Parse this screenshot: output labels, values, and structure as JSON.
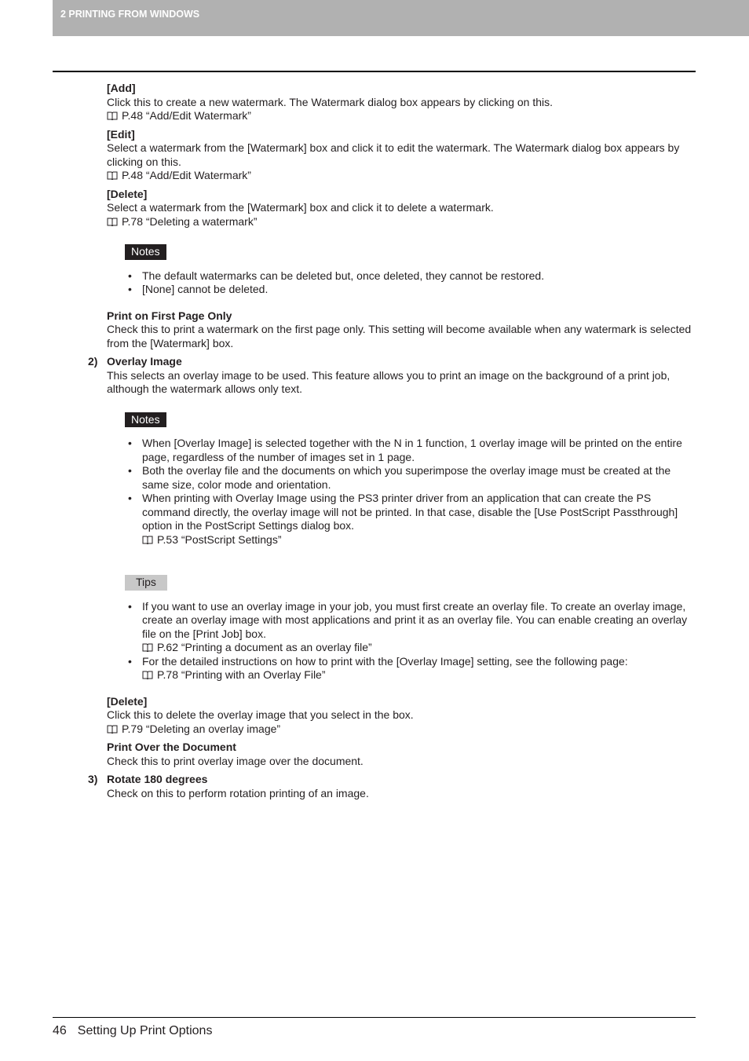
{
  "header": {
    "chapter": "2 PRINTING FROM WINDOWS"
  },
  "sections": {
    "add": {
      "title": "[Add]",
      "text": "Click this to create a new watermark.  The Watermark dialog box appears by clicking on this.",
      "ref": "P.48 “Add/Edit Watermark”"
    },
    "edit": {
      "title": "[Edit]",
      "text": "Select a watermark from the [Watermark] box and click it to edit the watermark.  The Watermark dialog box appears by clicking on this.",
      "ref": "P.48 “Add/Edit Watermark”"
    },
    "delete1": {
      "title": "[Delete]",
      "text": "Select a watermark from the [Watermark] box and click it to delete a watermark.",
      "ref": "P.78 “Deleting a watermark”"
    },
    "notes1": {
      "label": "Notes",
      "items": [
        "The default watermarks can be deleted but, once deleted, they cannot be restored.",
        "[None] cannot be deleted."
      ]
    },
    "first_page": {
      "title": "Print on First Page Only",
      "text": "Check this to print a watermark on the first page only. This setting will become available when any watermark is selected from the [Watermark] box."
    },
    "overlay": {
      "num": "2)",
      "title": "Overlay Image",
      "text": "This selects an overlay image to be used.  This feature allows you to print an image on the background of a print job, although the watermark allows only text."
    },
    "notes2": {
      "label": "Notes",
      "items": [
        "When [Overlay Image] is selected together with the N in 1 function, 1 overlay image will be printed on the entire page, regardless of the number of images set in 1 page.",
        "Both the overlay file and the documents on which you superimpose the overlay image must be created at the same size, color mode and orientation.",
        "When printing with Overlay Image using the PS3 printer driver from an application that can create the PS command directly, the overlay image will not be printed.  In that case, disable the [Use PostScript Passthrough] option in the PostScript Settings dialog box."
      ],
      "ref": "P.53 “PostScript Settings”"
    },
    "tips": {
      "label": "Tips",
      "item1": "If you want to use an overlay image in your job, you must first create an overlay file.  To create an overlay image, create an overlay image with most applications and print it as an overlay file.  You can enable creating an overlay file on the [Print Job] box.",
      "ref1": "P.62 “Printing a document as an overlay file”",
      "item2": "For the detailed instructions on how to print with the [Overlay Image] setting, see the following page:",
      "ref2": "P.78 “Printing with an Overlay File”"
    },
    "delete2": {
      "title": "[Delete]",
      "text": "Click this to delete the overlay image that you select in the box.",
      "ref": "P.79 “Deleting an overlay image”"
    },
    "over_doc": {
      "title": "Print Over the Document",
      "text": "Check this to print overlay image over the document."
    },
    "rotate": {
      "num": "3)",
      "title": "Rotate 180 degrees",
      "text": "Check on this to perform rotation printing of an image."
    }
  },
  "footer": {
    "page_number": "46",
    "title": "Setting Up Print Options"
  }
}
